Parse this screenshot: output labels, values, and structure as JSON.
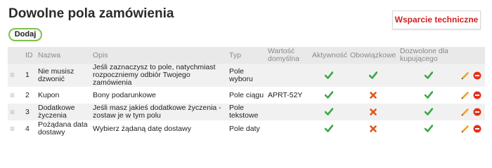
{
  "page": {
    "title": "Dowolne pola zamówienia",
    "add_label": "Dodaj",
    "support_label": "Wsparcie techniczne"
  },
  "table": {
    "headers": {
      "id": "ID",
      "name": "Nazwa",
      "desc": "Opis",
      "type": "Typ",
      "default": "Wartość domyślna",
      "active": "Aktywność",
      "required": "Obowiązkowe",
      "buyer": "Dozwolone dla kupującego"
    },
    "rows": [
      {
        "id": "1",
        "name": "Nie musisz dzwonić",
        "desc": "Jeśli zaznaczysz to pole, natychmiast rozpoczniemy odbiór Twojego zamówienia",
        "type": "Pole wyboru",
        "default": "",
        "active": true,
        "required": true,
        "buyer": true
      },
      {
        "id": "2",
        "name": "Kupon",
        "desc": "Bony podarunkowe",
        "type": "Pole ciągu",
        "default": "APRT-52Y",
        "active": true,
        "required": false,
        "buyer": true
      },
      {
        "id": "3",
        "name": "Dodatkowe życzenia",
        "desc": "Jeśli masz jakieś dodatkowe życzenia - zostaw je w tym polu",
        "type": "Pole tekstowe",
        "default": "",
        "active": true,
        "required": false,
        "buyer": true
      },
      {
        "id": "4",
        "name": "Pożądana data dostawy",
        "desc": "Wybierz żądaną datę dostawy",
        "type": "Pole daty",
        "default": "",
        "active": true,
        "required": false,
        "buyer": true
      }
    ]
  },
  "colors": {
    "check": "#3aa845",
    "cross": "#e0541b",
    "edit": "#f0a020",
    "delete": "#e4321b",
    "support_text": "#d21f1f",
    "add_border": "#7fc04a"
  },
  "icons": {
    "handle": "drag-handle-icon",
    "check": "check-icon",
    "cross": "cross-icon",
    "edit": "pencil-icon",
    "delete": "delete-icon"
  }
}
